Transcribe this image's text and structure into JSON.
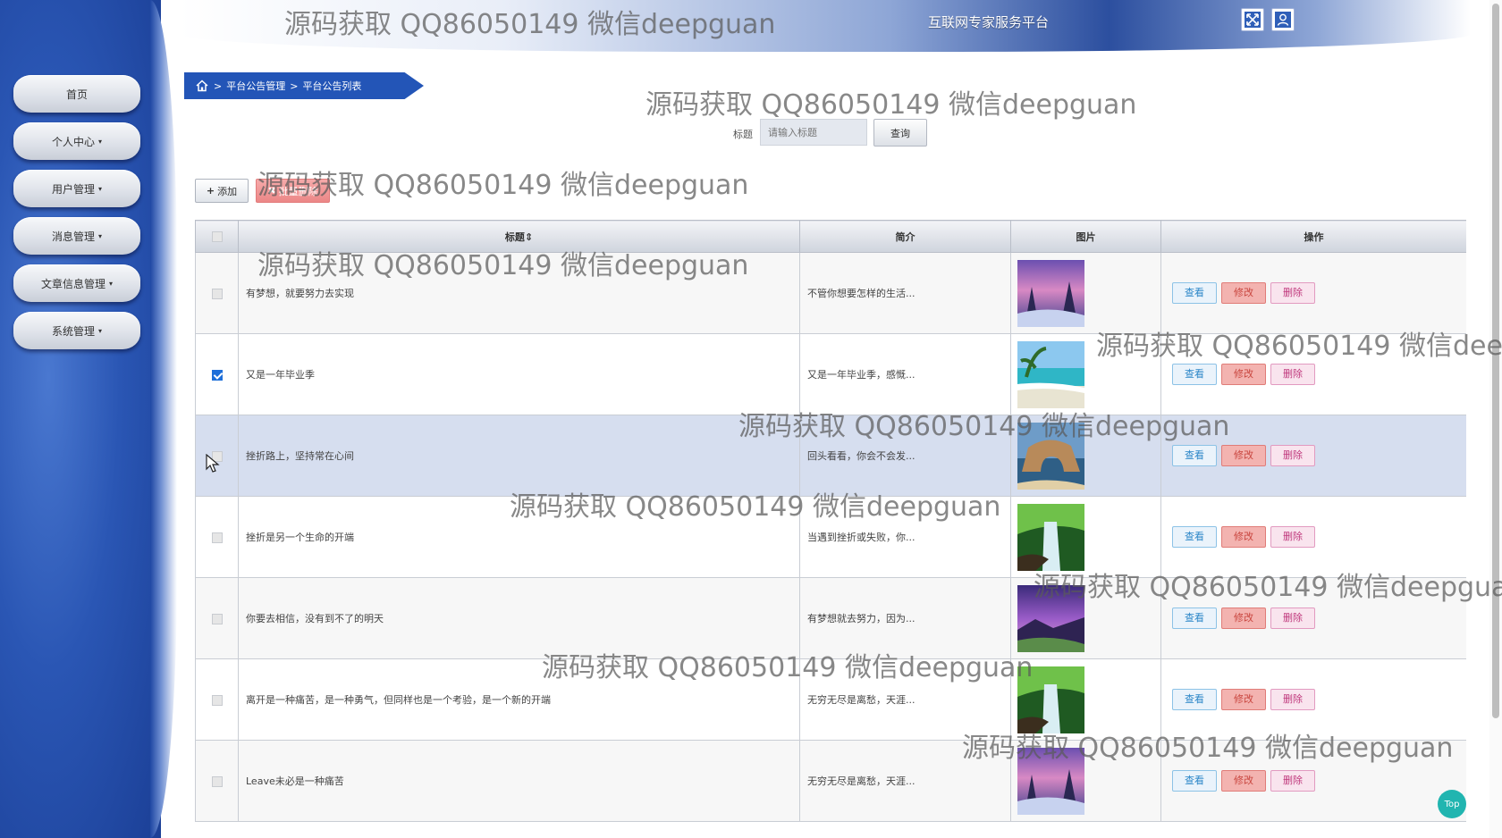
{
  "header": {
    "title": "互联网专家服务平台",
    "buttons": [
      {
        "icon": "fullscreen-icon"
      },
      {
        "icon": "user-icon"
      }
    ]
  },
  "sidebar": {
    "items": [
      {
        "label": "首页",
        "has_caret": false
      },
      {
        "label": "个人中心",
        "has_caret": true
      },
      {
        "label": "用户管理",
        "has_caret": true
      },
      {
        "label": "消息管理",
        "has_caret": true
      },
      {
        "label": "文章信息管理",
        "has_caret": true
      },
      {
        "label": "系统管理",
        "has_caret": true
      }
    ],
    "caret_glyph": "▾"
  },
  "breadcrumb": {
    "icon": "home-icon",
    "separator": ">",
    "items": [
      "平台公告管理",
      "平台公告列表"
    ]
  },
  "search": {
    "label": "标题",
    "placeholder": "请输入标题",
    "button_label": "查询"
  },
  "actions": {
    "add_symbol": "+",
    "add_label": "添加",
    "batch_delete_symbol": "✖",
    "batch_delete_label": "批量删除"
  },
  "table": {
    "headers": {
      "title": "标题",
      "title_sort_icon": "⇕",
      "summary": "简介",
      "image": "图片",
      "operations": "操作"
    },
    "op_labels": {
      "view": "查看",
      "edit": "修改",
      "delete": "删除"
    },
    "rows": [
      {
        "title": "有梦想，就要努力去实现",
        "summary": "不管你想要怎样的生活...",
        "image": "purple-snowy-forest",
        "checked": false
      },
      {
        "title": "又是一年毕业季",
        "summary": "又是一年毕业季，感慨...",
        "image": "tropical-beach",
        "checked": true
      },
      {
        "title": "挫折路上，坚持常在心间",
        "summary": "回头看看，你会不会发...",
        "image": "sea-rock-arch",
        "checked": false
      },
      {
        "title": "挫折是另一个生命的开端",
        "summary": "当遇到挫折或失败，你...",
        "image": "green-waterfall",
        "checked": false
      },
      {
        "title": "你要去相信，没有到不了的明天",
        "summary": "有梦想就去努力，因为...",
        "image": "purple-coast-sunset",
        "checked": false
      },
      {
        "title": "离开是一种痛苦，是一种勇气，但同样也是一个考验，是一个新的开端",
        "summary": "无穷无尽是离愁，天涯...",
        "image": "green-waterfall",
        "checked": false
      },
      {
        "title": "Leave未必是一种痛苦",
        "summary": "无穷无尽是离愁，天涯...",
        "image": "purple-snowy-forest",
        "checked": false
      }
    ]
  },
  "watermark_text": "源码获取 QQ86050149 微信deepguan",
  "top_button_label": "Top",
  "colors": {
    "sidebar": "#2a56b4",
    "breadcrumb": "#2355b7",
    "view": "#2b86c8",
    "edit": "#c9463f",
    "delete": "#c0397d",
    "top": "#21b5b0"
  }
}
